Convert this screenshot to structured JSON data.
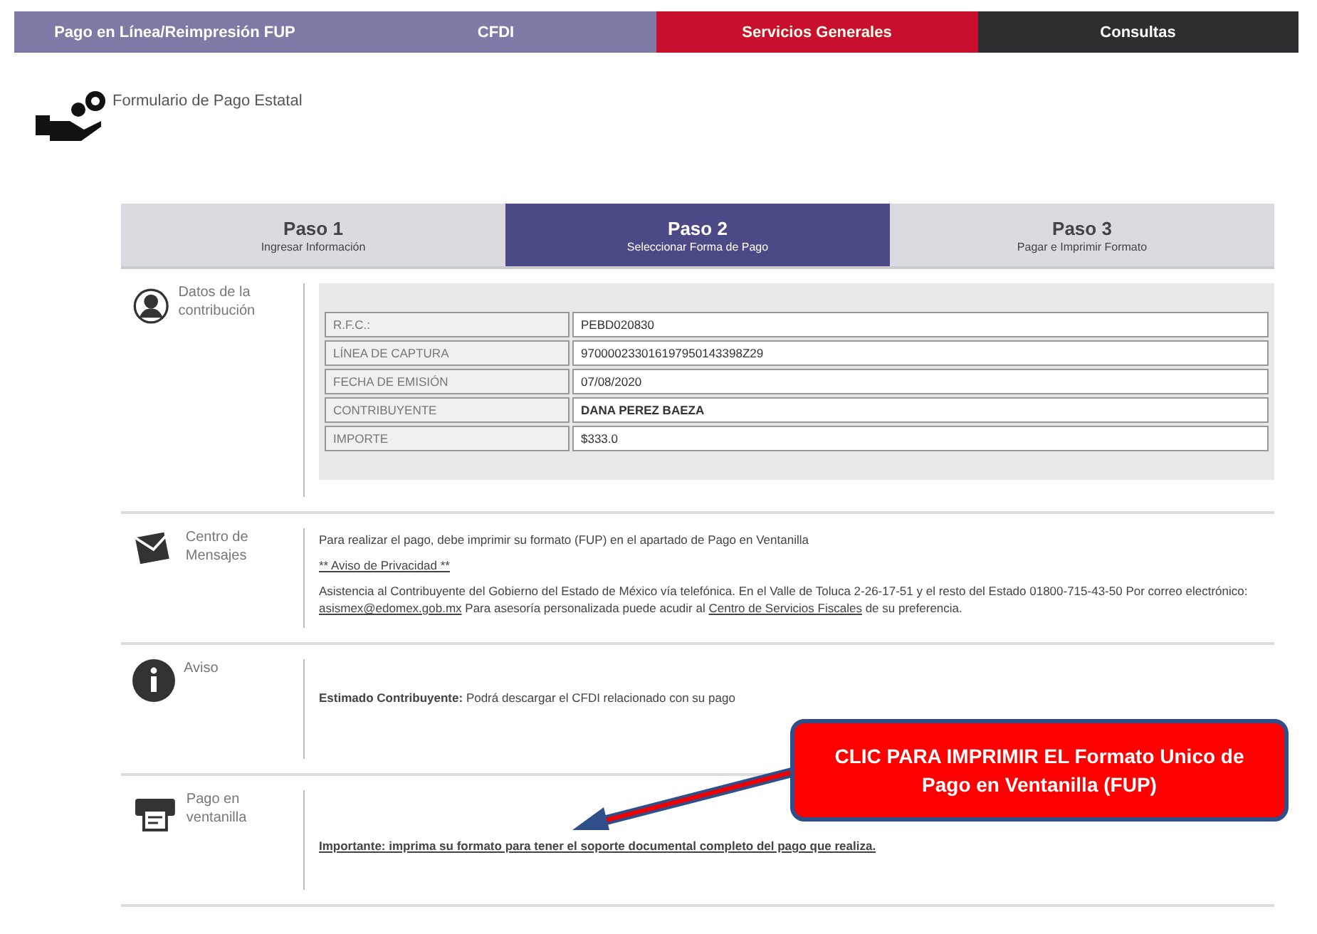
{
  "nav": [
    {
      "label": "Pago en Línea/Reimpresión FUP",
      "selected": false,
      "color": "#7d7ba6"
    },
    {
      "label": "CFDI",
      "selected": false,
      "color": "#7d7ba6"
    },
    {
      "label": "Servicios Generales",
      "selected": true,
      "color": "#c8102e"
    },
    {
      "label": "Consultas",
      "selected": false,
      "color": "#2e2e30"
    }
  ],
  "page_title": "Formulario de Pago Estatal",
  "steps": [
    {
      "title": "Paso 1",
      "subtitle": "Ingresar Información",
      "selected": false
    },
    {
      "title": "Paso 2",
      "subtitle": "Seleccionar Forma de Pago",
      "selected": true
    },
    {
      "title": "Paso 3",
      "subtitle": "Pagar e Imprimir Formato",
      "selected": false
    }
  ],
  "sections": [
    {
      "kind": "table",
      "label": "Datos de la contribución",
      "rows": [
        {
          "label": "R.F.C.:",
          "value": "PEBD020830",
          "bold": false
        },
        {
          "label": "LÍNEA DE CAPTURA",
          "value": "970000233016197950143398Z29",
          "bold": false
        },
        {
          "label": "FECHA DE EMISIÓN",
          "value": "07/08/2020",
          "bold": false
        },
        {
          "label": "CONTRIBUYENTE",
          "value": "DANA PEREZ BAEZA",
          "bold": true
        },
        {
          "label": "IMPORTE",
          "value": "$333.0",
          "bold": false
        }
      ]
    },
    {
      "kind": "messages",
      "label": "Centro de Mensajes",
      "paragraphs": [
        [
          {
            "kind": "text",
            "text": "Para realizar el pago, debe imprimir su formato (FUP) en el apartado de Pago en Ventanilla"
          }
        ],
        [
          {
            "kind": "link",
            "text": "** Aviso de Privacidad **"
          }
        ],
        [
          {
            "kind": "text",
            "text": "Asistencia al Contribuyente del Gobierno del Estado de México vía telefónica. En el Valle de Toluca 2-26-17-51 y el resto del Estado 01800-715-43-50 Por correo electrónico:"
          },
          {
            "kind": "link",
            "text": "asismex@edomex.gob.mx"
          },
          {
            "kind": "text",
            "text": "Para asesoría personalizada puede acudir al"
          },
          {
            "kind": "link",
            "text": "Centro de Servicios Fiscales"
          },
          {
            "kind": "text",
            "text": "de su preferencia."
          }
        ]
      ]
    },
    {
      "kind": "notice",
      "label": "Aviso",
      "strong": "Estimado Contribuyente:",
      "text": "Podrá descargar el CFDI relacionado con su pago"
    },
    {
      "kind": "print",
      "label": "Pago en ventanilla",
      "link": "Importante: imprima su formato para tener el soporte documental completo del pago que realiza."
    }
  ],
  "callout": {
    "text": "CLIC PARA IMPRIMIR EL Formato Unico de Pago en Ventanilla (FUP)"
  }
}
